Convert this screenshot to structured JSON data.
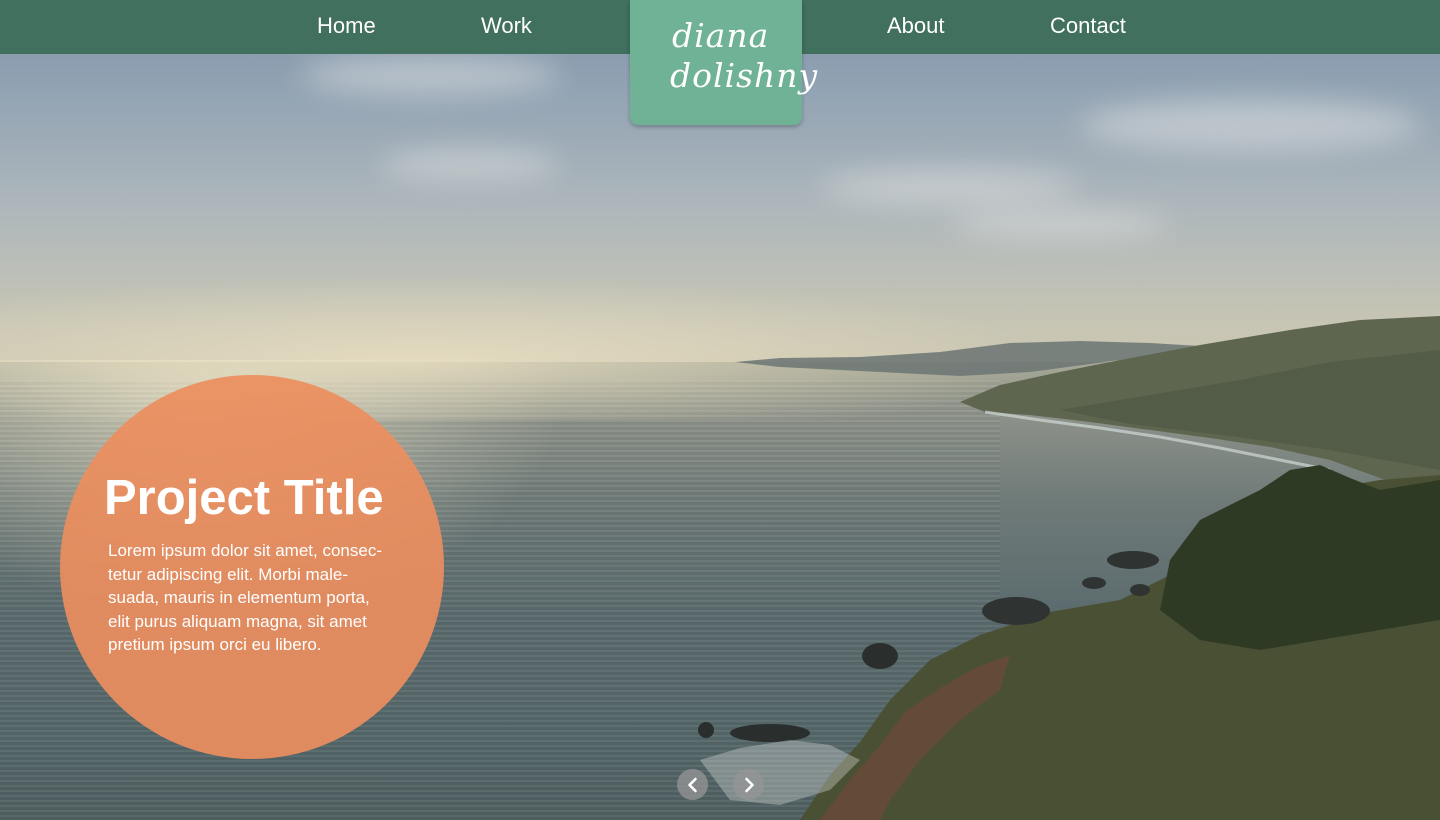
{
  "nav": {
    "items": [
      {
        "label": "Home"
      },
      {
        "label": "Work"
      },
      {
        "label": "About"
      },
      {
        "label": "Contact"
      }
    ]
  },
  "logo": {
    "line1": "diana",
    "line2": "dolishny",
    "color": "#6fb295"
  },
  "hero": {
    "title": "Project Title",
    "description_lines": [
      "Lorem ipsum dolor sit amet, consec-",
      "tetur adipiscing elit. Morbi male-",
      "suada, mauris in elementum porta,",
      "elit purus aliquam magna, sit amet",
      "pretium ipsum orci eu libero."
    ],
    "accent": "#ec8e5e"
  },
  "slider": {
    "prev_icon": "chevron-left-icon",
    "next_icon": "chevron-right-icon"
  },
  "colors": {
    "navbar": "#41705e",
    "logo_tab": "#6fb295",
    "circle": "#ec8e5e"
  }
}
